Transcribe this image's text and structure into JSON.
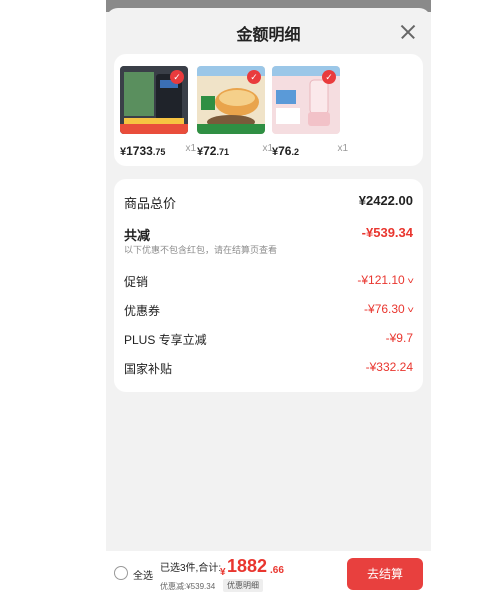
{
  "sheet": {
    "title": "金额明细"
  },
  "products": [
    {
      "name": "water-heater",
      "currency": "¥",
      "main": "1733",
      "frac": ".75",
      "qty": "x1",
      "thumb_color": "#3a3f48",
      "strip_color": "#e94d3b"
    },
    {
      "name": "cooker",
      "currency": "¥",
      "main": "72",
      "frac": ".71",
      "qty": "x1",
      "thumb_color": "#f0e3c8",
      "strip_color": "#2f8f43"
    },
    {
      "name": "blender",
      "currency": "¥",
      "main": "76",
      "frac": ".2",
      "qty": "x1",
      "thumb_color": "#f5dde0",
      "strip_color": "#5a9ad8"
    }
  ],
  "details": {
    "goods_total_label": "商品总价",
    "goods_total_value": "¥2422.00",
    "total_reduce_label": "共减",
    "total_reduce_value": "-¥539.34",
    "note": "以下优惠不包含红包，请在结算页查看",
    "promo_label": "促销",
    "promo_value": "-¥121.10",
    "coupon_label": "优惠券",
    "coupon_value": "-¥76.30",
    "plus_label": "PLUS 专享立减",
    "plus_value": "-¥9.7",
    "subsidy_label": "国家补贴",
    "subsidy_value": "-¥332.24"
  },
  "bottom": {
    "select_all": "全选",
    "summary": "已选3件,合计:",
    "total_currency": "¥",
    "total_main": "1882",
    "total_frac": ".66",
    "discount": "优惠减:¥539.34",
    "detail_tag": "优惠明细",
    "checkout": "去结算"
  },
  "colors": {
    "accent": "#e9362f",
    "button": "#e8403e"
  }
}
